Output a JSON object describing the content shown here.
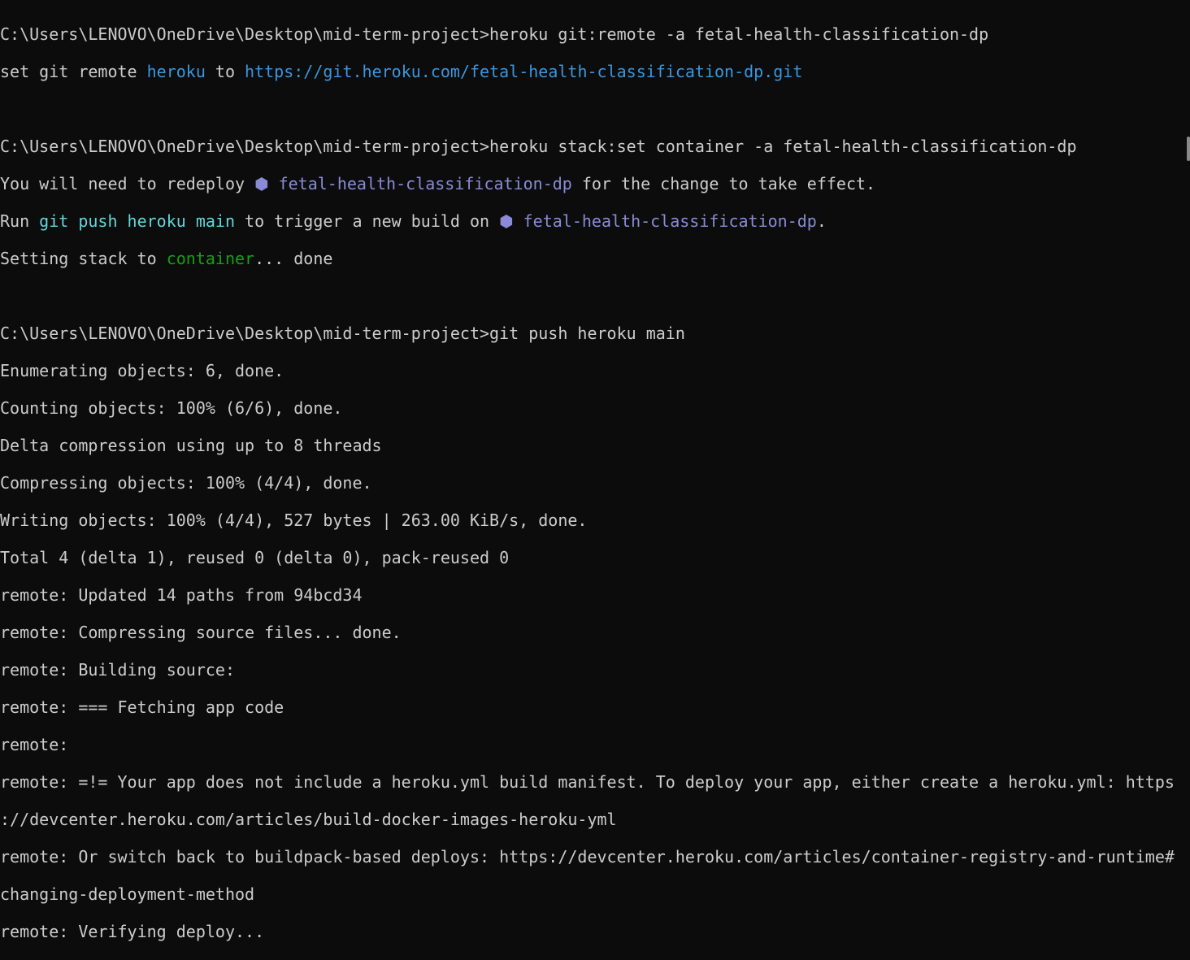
{
  "colors": {
    "background": "#0c0c0c",
    "text": "#cccccc",
    "link": "#3a96dd",
    "app": "#8a8ad6",
    "command": "#61d6d6",
    "success": "#13a10e"
  },
  "icons": {
    "app_bullet": "hexagon-icon"
  },
  "lines": {
    "l1": "C:\\Users\\LENOVO\\OneDrive\\Desktop\\mid-term-project>heroku git:remote -a fetal-health-classification-dp",
    "l2a": "set git remote ",
    "l2b": "heroku",
    "l2c": " to ",
    "l2d": "https://git.heroku.com/fetal-health-classification-dp.git",
    "l4": "C:\\Users\\LENOVO\\OneDrive\\Desktop\\mid-term-project>heroku stack:set container -a fetal-health-classification-dp",
    "l5a": "You will need to redeploy ",
    "l5b": "⬢ fetal-health-classification-dp",
    "l5c": " for the change to take effect.",
    "l6a": "Run ",
    "l6b": "git push heroku main",
    "l6c": " to trigger a new build on ",
    "l6d": "⬢ fetal-health-classification-dp",
    "l6e": ".",
    "l7a": "Setting stack to ",
    "l7b": "container",
    "l7c": "... done",
    "l9": "C:\\Users\\LENOVO\\OneDrive\\Desktop\\mid-term-project>git push heroku main",
    "l10": "Enumerating objects: 6, done.",
    "l11": "Counting objects: 100% (6/6), done.",
    "l12": "Delta compression using up to 8 threads",
    "l13": "Compressing objects: 100% (4/4), done.",
    "l14": "Writing objects: 100% (4/4), 527 bytes | 263.00 KiB/s, done.",
    "l15": "Total 4 (delta 1), reused 0 (delta 0), pack-reused 0",
    "l16": "remote: Updated 14 paths from 94bcd34",
    "l17": "remote: Compressing source files... done.",
    "l18": "remote: Building source:",
    "l19": "remote: === Fetching app code",
    "l20": "remote:",
    "l21": "remote: =!= Your app does not include a heroku.yml build manifest. To deploy your app, either create a heroku.yml: https",
    "l22": "://devcenter.heroku.com/articles/build-docker-images-heroku-yml",
    "l23": "remote: Or switch back to buildpack-based deploys: https://devcenter.heroku.com/articles/container-registry-and-runtime#",
    "l24": "changing-deployment-method",
    "l25": "remote: Verifying deploy..."
  }
}
